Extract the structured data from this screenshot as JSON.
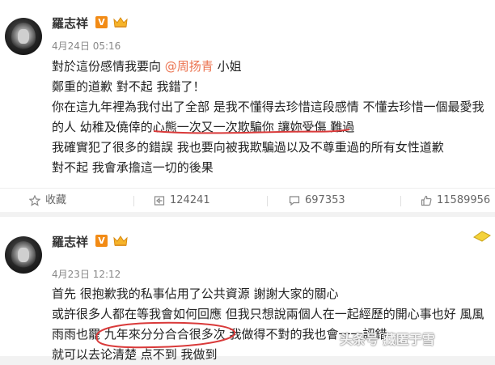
{
  "posts": [
    {
      "username": "羅志祥",
      "verified_badge": "V",
      "timestamp": "4月24日 05:16",
      "lines": [
        {
          "pre": "對於這份感情我要向 ",
          "mention": "@周扬青",
          "post": " 小姐"
        },
        {
          "pre": "鄭重的道歉 對不起 我錯了！",
          "mention": "",
          "post": ""
        },
        {
          "pre": "你在這九年裡為我付出了全部 是我不懂得去珍惜這段感情 不懂去珍惜一個最愛我",
          "mention": "",
          "post": ""
        },
        {
          "pre": "的人 幼稚及僥倖的心態一次又一次欺騙你 讓妳受傷 難過",
          "mention": "",
          "post": ""
        },
        {
          "pre": "我確實犯了很多的錯誤 我也要向被我欺騙過以及不尊重過的所有女性道歉",
          "mention": "",
          "post": ""
        },
        {
          "pre": "對不起   我會承擔這一切的後果",
          "mention": "",
          "post": ""
        }
      ],
      "actions": {
        "favorite": "收藏",
        "repost": "124241",
        "comment": "697353",
        "like": "11589956"
      }
    },
    {
      "username": "羅志祥",
      "verified_badge": "V",
      "timestamp": "4月23日 12:12",
      "lines": [
        {
          "pre": "首先 很抱歉我的私事佔用了公共資源 謝謝大家的關心",
          "mention": "",
          "post": ""
        },
        {
          "pre": "或許很多人都在等我會如何回應 但我只想說兩個人在一起經歷的開心事也好 風風",
          "mention": "",
          "post": ""
        },
        {
          "pre": "雨雨也罷 九年來分分合合很多次 我做得不對的我也會一一認錯",
          "mention": "",
          "post": ""
        },
        {
          "pre": "就可以去论清楚 点不到 我做到",
          "mention": "",
          "post": ""
        }
      ]
    }
  ],
  "watermark": "头条号 藏匿于雪",
  "colors": {
    "mention": "#eb7350",
    "badge": "#f28b16",
    "underline": "#d93a3a"
  },
  "icons": [
    "favorite-icon",
    "repost-icon",
    "comment-icon",
    "like-icon",
    "crown-icon",
    "lion-avatar"
  ]
}
